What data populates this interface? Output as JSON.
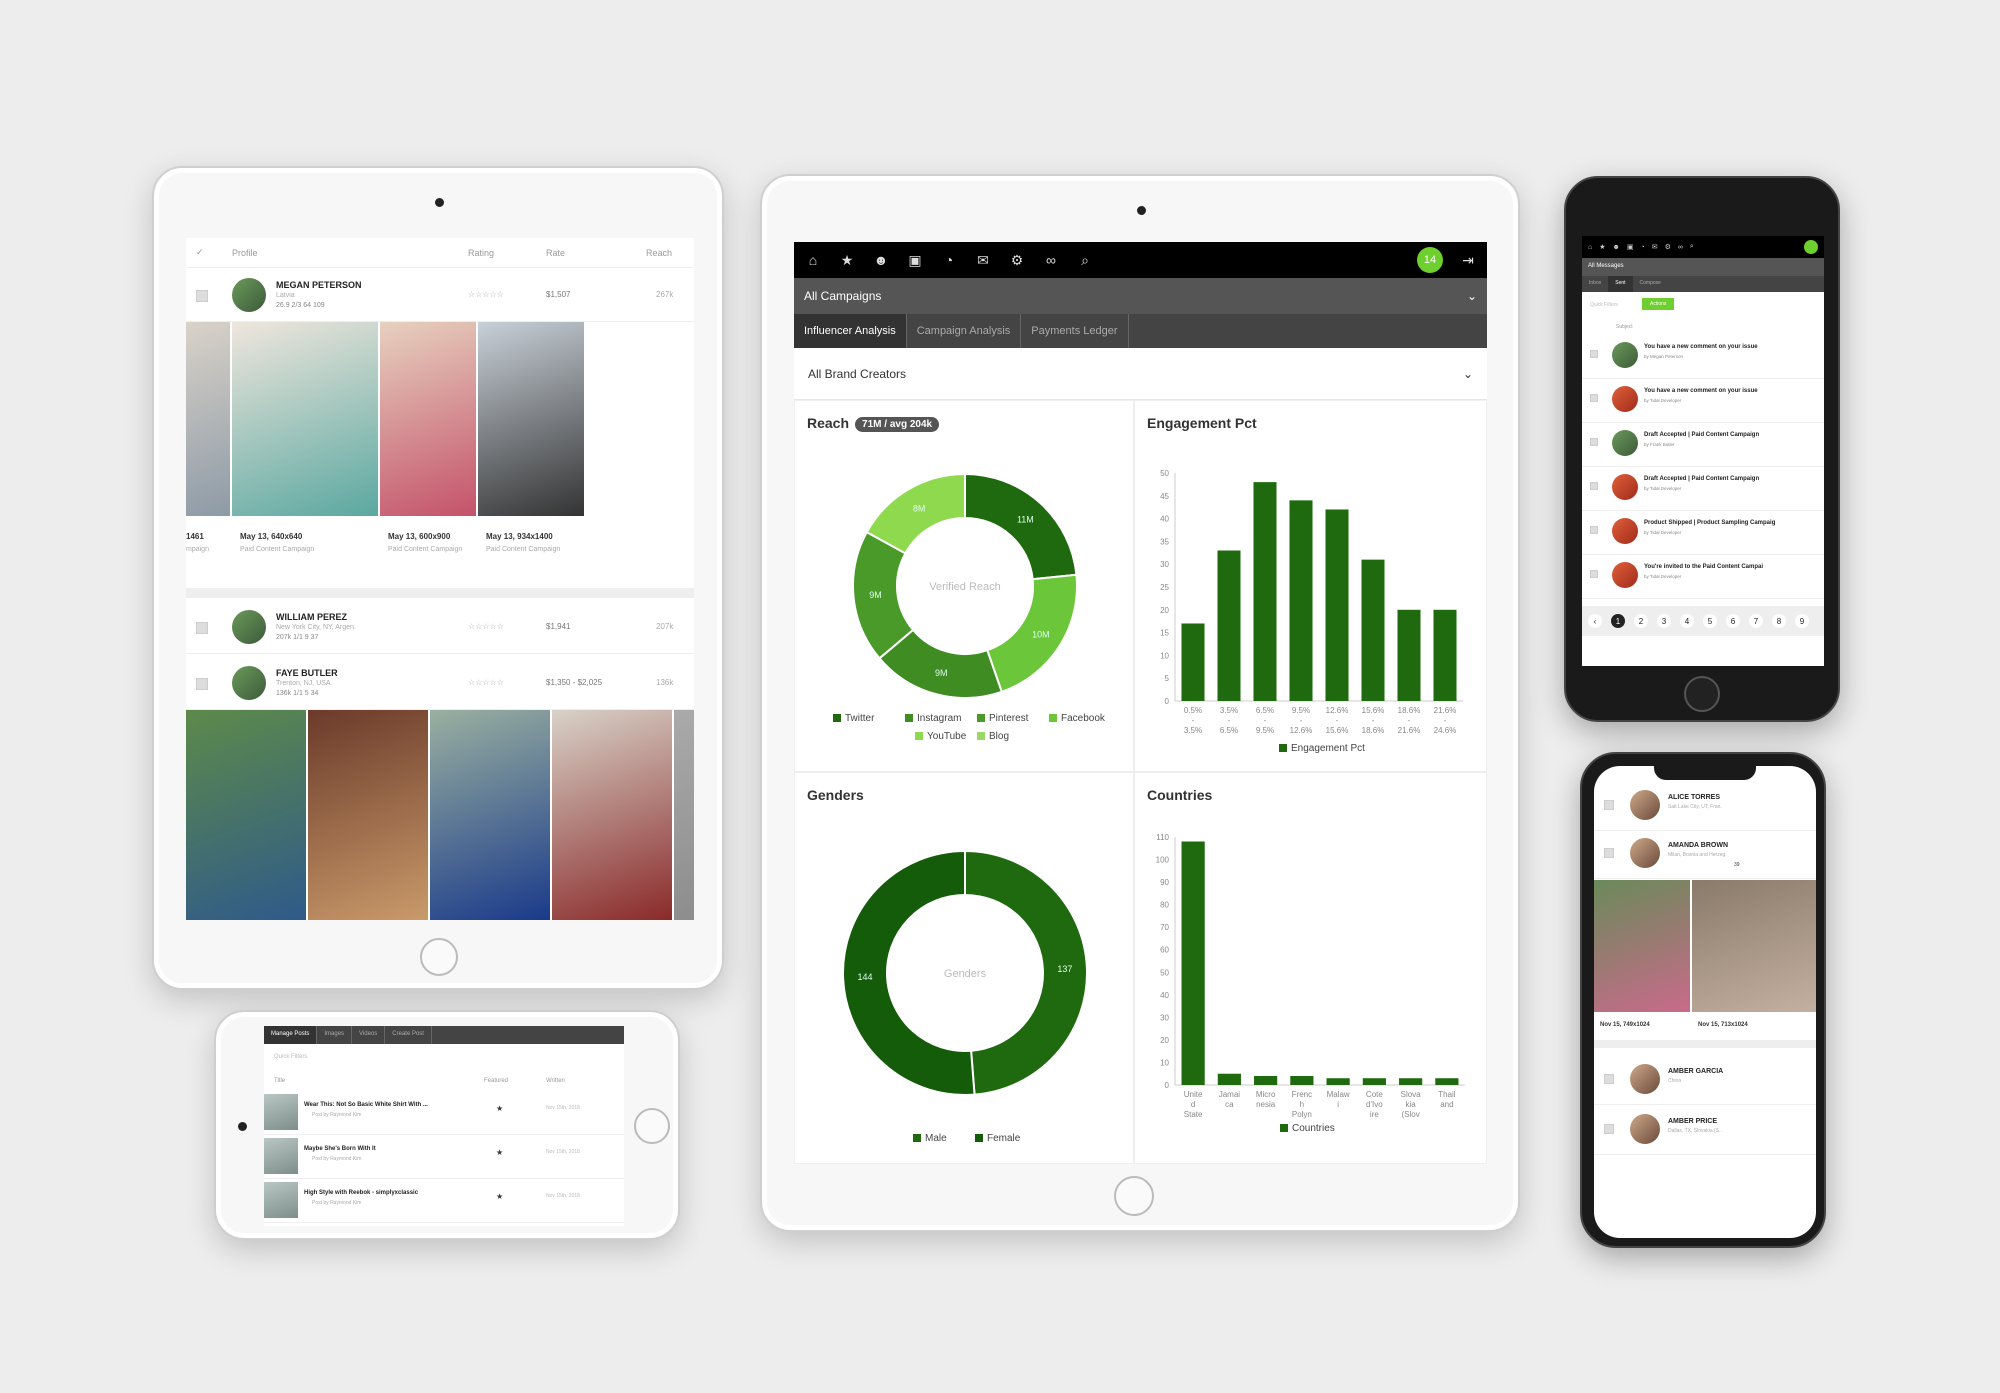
{
  "colors": {
    "accent": "#6fcf2f",
    "dark_green": "#1f6a0e",
    "mid_green": "#3e8c22",
    "light_green": "#6cc63a",
    "lighter_green": "#8fd94f",
    "topbar": "#000000",
    "bar": "#555555"
  },
  "big_tablet": {
    "nav_icons": [
      "home-icon",
      "star-icon",
      "users-icon",
      "image-icon",
      "pie-icon",
      "mail-icon",
      "gear-icon",
      "link-icon",
      "search-icon"
    ],
    "badge": "14",
    "campaign_select": "All Campaigns",
    "tabs": [
      {
        "label": "Influencer Analysis",
        "active": true
      },
      {
        "label": "Campaign Analysis",
        "active": false
      },
      {
        "label": "Payments Ledger",
        "active": false
      }
    ],
    "creator_select": "All Brand Creators",
    "reach": {
      "title": "Reach",
      "pill": "71M / avg 204k",
      "center": "Verified Reach"
    },
    "engagement": {
      "title": "Engagement Pct",
      "legend": "Engagement Pct"
    },
    "genders": {
      "title": "Genders",
      "center": "Genders"
    },
    "countries": {
      "title": "Countries",
      "legend": "Countries"
    }
  },
  "chart_data": [
    {
      "type": "pie",
      "title": "Reach",
      "labels": [
        "Twitter",
        "Instagram",
        "Pinterest",
        "Facebook",
        "YouTube",
        "Blog"
      ],
      "values": [
        11,
        10,
        9,
        9,
        8,
        0
      ],
      "slice_labels": [
        "11M",
        "10M",
        "9M",
        "9M",
        "8M",
        ""
      ],
      "legend": [
        "Twitter",
        "Instagram",
        "Pinterest",
        "Facebook",
        "YouTube",
        "Blog"
      ]
    },
    {
      "type": "bar",
      "title": "Engagement Pct",
      "categories": [
        "0.5% - 3.5%",
        "3.5% - 6.5%",
        "6.5% - 9.5%",
        "9.5% - 12.6%",
        "12.6% - 15.6%",
        "15.6% - 18.6%",
        "18.6% - 21.6%",
        "21.6% - 24.6%"
      ],
      "values": [
        17,
        33,
        48,
        44,
        42,
        31,
        20,
        20
      ],
      "ylim": [
        0,
        50
      ],
      "yticks": [
        0,
        5,
        10,
        15,
        20,
        25,
        30,
        35,
        40,
        45,
        50
      ],
      "legend": "Engagement Pct"
    },
    {
      "type": "pie",
      "title": "Genders",
      "labels": [
        "Male",
        "Female"
      ],
      "values": [
        137,
        144
      ],
      "slice_labels": [
        "137",
        "144"
      ]
    },
    {
      "type": "bar",
      "title": "Countries",
      "categories": [
        "United States",
        "Jamaica",
        "Micronesia",
        "French Polynesia",
        "Malawi",
        "Cote d'Ivoire",
        "Slovakia (Slovak Republic)",
        "Thailand"
      ],
      "tick_labels": [
        "Unite d State",
        "Jamai ca",
        "Micro nesia",
        "Frenc h Polyn",
        "Malaw i",
        "Cote d'Ivo ire",
        "Slova kia (Slov",
        "Thail and"
      ],
      "values": [
        108,
        5,
        4,
        4,
        3,
        3,
        3,
        3
      ],
      "ylim": [
        0,
        110
      ],
      "yticks": [
        0,
        10,
        20,
        30,
        40,
        50,
        60,
        70,
        80,
        90,
        100,
        110
      ],
      "legend": "Countries"
    }
  ],
  "left_tablet": {
    "headers": [
      "Profile",
      "Rating",
      "Rate",
      "Reach"
    ],
    "rows": [
      {
        "name": "MEGAN PETERSON",
        "loc": "Latvia",
        "stats": "26.9  2/3  64  109",
        "rate": "$1,507",
        "reach": "267k"
      },
      {
        "name": "WILLIAM PEREZ",
        "loc": "New York City, NY, Argen.",
        "stats": "207k  1/1  9  37",
        "rate": "$1,941",
        "reach": "207k"
      },
      {
        "name": "FAYE BUTLER",
        "loc": "Trenton, NJ, USA",
        "stats": "136k  1/1  5  34",
        "rate": "$1,350 - $2,025",
        "reach": "136k"
      }
    ],
    "posts": [
      {
        "title": "1461",
        "sub": "mpaign"
      },
      {
        "title": "May 13, 640x640",
        "sub": "Paid Content Campaign"
      },
      {
        "title": "May 13, 600x900",
        "sub": "Paid Content Campaign"
      },
      {
        "title": "May 13, 934x1400",
        "sub": "Paid Content Campaign"
      }
    ]
  },
  "small_phone": {
    "tabs": [
      "Manage Posts",
      "Images",
      "Videos",
      "Create Post"
    ],
    "filter": "Quick Filters",
    "headers": [
      "Title",
      "Featured",
      "Written"
    ],
    "rows": [
      {
        "title": "Wear This: Not So Basic White Shirt With ...",
        "by": "Post by Raymond Kim",
        "date": "Nov 15th, 2018"
      },
      {
        "title": "Maybe She's Born With It",
        "by": "Post by Raymond Kim",
        "date": "Nov 15th, 2018"
      },
      {
        "title": "High Style with Reebok - simplyxclassic",
        "by": "Post by Raymond Kim",
        "date": "Nov 15th, 2018"
      }
    ]
  },
  "phone_top": {
    "select": "All Messages",
    "tabs": [
      "Inbox",
      "Sent",
      "Compose"
    ],
    "filter": "Quick Filters",
    "action": "Actions",
    "header": "Subject",
    "messages": [
      {
        "subject": "You have a new comment on your issue",
        "by": "by Megan Peterson"
      },
      {
        "subject": "You have a new comment on your issue",
        "by": "by Tidal Developer"
      },
      {
        "subject": "Draft Accepted | Paid Content Campaign",
        "by": "by Frank Butler"
      },
      {
        "subject": "Draft Accepted | Paid Content Campaign",
        "by": "by Tidal Developer"
      },
      {
        "subject": "Product Shipped | Product Sampling Campaig",
        "by": "by Tidal Developer"
      },
      {
        "subject": "You're invited to the Paid Content Campai",
        "by": "by Tidal Developer"
      }
    ],
    "pages": [
      "‹",
      "1",
      "2",
      "3",
      "4",
      "5",
      "6",
      "7",
      "8",
      "9"
    ]
  },
  "phone_bottom": {
    "rows": [
      {
        "name": "ALICE TORRES",
        "loc": "Salt Lake City, UT, Fran."
      },
      {
        "name": "AMANDA BROWN",
        "loc": "Milan, Bosnia and Herzeg.",
        "count": "39"
      },
      {
        "name": "AMBER GARCIA",
        "loc": "China"
      },
      {
        "name": "AMBER PRICE",
        "loc": "Dallas, TX, Slovakia (S..."
      }
    ],
    "posts": [
      {
        "title": "Nov 15, 749x1024"
      },
      {
        "title": "Nov 15, 713x1024"
      }
    ]
  }
}
